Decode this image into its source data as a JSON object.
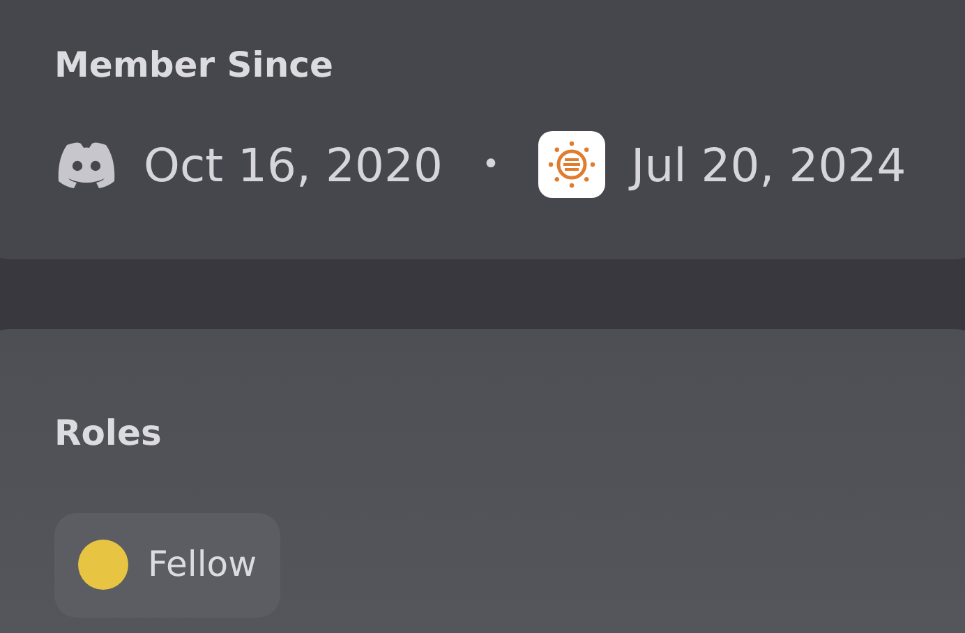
{
  "member_since": {
    "title": "Member Since",
    "discord_date": "Oct 16, 2020",
    "separator": "•",
    "server_date": "Jul 20, 2024"
  },
  "roles": {
    "title": "Roles",
    "items": [
      {
        "name": "Fellow",
        "color": "#e8c443"
      }
    ]
  }
}
